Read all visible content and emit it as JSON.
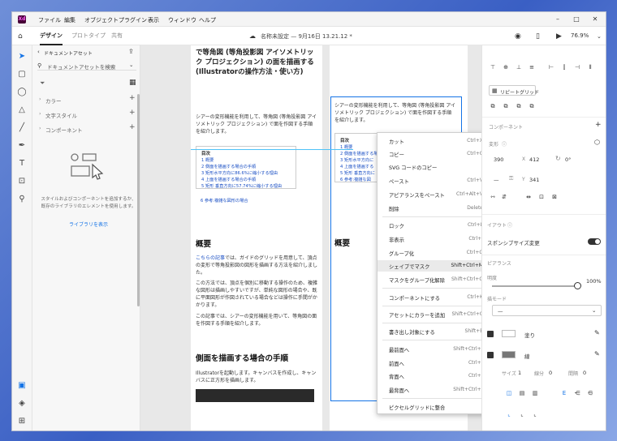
{
  "titlebar": {
    "app_icon": "Xd",
    "menus": [
      "ファイル",
      "編集",
      "オブジェクト",
      "プラグイン",
      "表示",
      "ウィンドウ",
      "ヘルプ"
    ],
    "min_icon": "minimize-icon",
    "max_icon": "maximize-icon",
    "close_icon": "close-icon"
  },
  "toolbar": {
    "tabs": [
      "デザイン",
      "プロトタイプ",
      "共有"
    ],
    "doc_title": "名称未設定 — 9月16日 13.21.12 *",
    "zoom": "76.9%"
  },
  "library": {
    "header": "ドキュメントアセット",
    "search_placeholder": "ドキュメントアセットを検索",
    "sections": [
      "カラー",
      "文字スタイル",
      "コンポーネント"
    ],
    "empty_text": "スタイルおよびコンポーネントを追加するか、既存のライブラリのエレメントを使用します。",
    "library_link": "ライブラリを表示"
  },
  "artboard1": {
    "heading": "で等角図 (等角投影図 アイソメトリック プロジェクション) の面を描画する (Illustratorの操作方法・使い方)",
    "intro": "シアーの変形機能を利用して、等角図 (等角投影図 アイソメトリック プロジェクション) で面を作図する手順を紹介します。",
    "toc_title": "目次",
    "toc": [
      "1 概要",
      "2 側面を描画する場合の手順",
      "3 矩形水平方向に86.6%に縮小する理由",
      "4 上面を描画する場合の手順",
      "5 矩形 垂直方向に57.74%に縮小する理由",
      "6 参考:複雑な図形の場合"
    ],
    "h_overview": "概要",
    "link_text": "こちらの記事",
    "p1": "では、ガイドのグリッドを用意して、頂点の変形で等角投影図の図形を描画する方法を紹介しました。",
    "p2": "この方法では、頂点を個別に移動する操作のため、複雑な図形は描画しやすいですが、単純な図形の場合や、既に平面図形が作図されている場合などは操作に手間がかかります。",
    "p3": "この記事では、シアーの変形機能を用いて、等角図の面を作図する手順を紹介します。",
    "h_side": "側面を描画する場合の手順",
    "p4": "Illustratorを起動します。キャンバスを作成し、キャンバスに正方形を描画します。"
  },
  "artboard2": {
    "intro": "シアーの変形機能を利用して、等角図 (等角投影図 アイソメトリック プロジェクション) で面を作図する手順を紹介します。",
    "toc_title": "目次",
    "toc": [
      "1 概要",
      "2 側面を描画する場",
      "3 矩形水平方向に",
      "4 上面を描画する",
      "5 矩形 垂直方向に",
      "6 参考:複雑な図"
    ],
    "h_overview": "概要"
  },
  "context_menu": {
    "items": [
      {
        "label": "カット",
        "shortcut": "Ctrl+X"
      },
      {
        "label": "コピー",
        "shortcut": "Ctrl+C"
      },
      {
        "label": "SVG コードのコピー",
        "shortcut": ""
      },
      {
        "label": "ペースト",
        "shortcut": "Ctrl+V"
      },
      {
        "label": "アピアランスをペースト",
        "shortcut": "Ctrl+Alt+V"
      },
      {
        "label": "削除",
        "shortcut": "Delete"
      },
      {
        "label": "ロック",
        "shortcut": "Ctrl+L"
      },
      {
        "label": "非表示",
        "shortcut": "Ctrl+,"
      },
      {
        "label": "グループ化",
        "shortcut": "Ctrl+G"
      },
      {
        "label": "シェイプでマスク",
        "shortcut": "Shift+Ctrl+M"
      },
      {
        "label": "マスクをグループ化解除",
        "shortcut": "Shift+Ctrl+G"
      },
      {
        "label": "コンポーネントにする",
        "shortcut": "Ctrl+K"
      },
      {
        "label": "アセットにカラーを追加",
        "shortcut": "Shift+Ctrl+C"
      },
      {
        "label": "書き出し対象にする",
        "shortcut": "Shift+E"
      },
      {
        "label": "最前面へ",
        "shortcut": "Shift+Ctrl+]"
      },
      {
        "label": "前面へ",
        "shortcut": "Ctrl+]"
      },
      {
        "label": "背面へ",
        "shortcut": "Ctrl+["
      },
      {
        "label": "最背面へ",
        "shortcut": "Shift+Ctrl+["
      },
      {
        "label": "ピクセルグリッドに整合",
        "shortcut": ""
      }
    ]
  },
  "properties": {
    "repeat_grid": "リピートグリッド",
    "component_label": "コンポーネント",
    "transform_label": "変形",
    "w_value": "390",
    "x_label": "X",
    "x_value": "412",
    "rotation": "0°",
    "h_value": "—",
    "y_label": "Y",
    "y_value": "341",
    "layout_label": "イアウト",
    "responsive_label": "スポンシブサイズ変更",
    "appearance_label": "ピアランス",
    "opacity_label": "明度",
    "opacity_value": "100%",
    "blend_label": "描モード",
    "blend_value": "—",
    "fill_label": "塗り",
    "stroke_label": "線",
    "size_label": "サイズ",
    "size_value": "1",
    "dash_label": "線分",
    "dash_value": "0",
    "gap_label": "間隔",
    "gap_value": "0",
    "stroke_color": "#777777",
    "accent": "#1473e6"
  }
}
